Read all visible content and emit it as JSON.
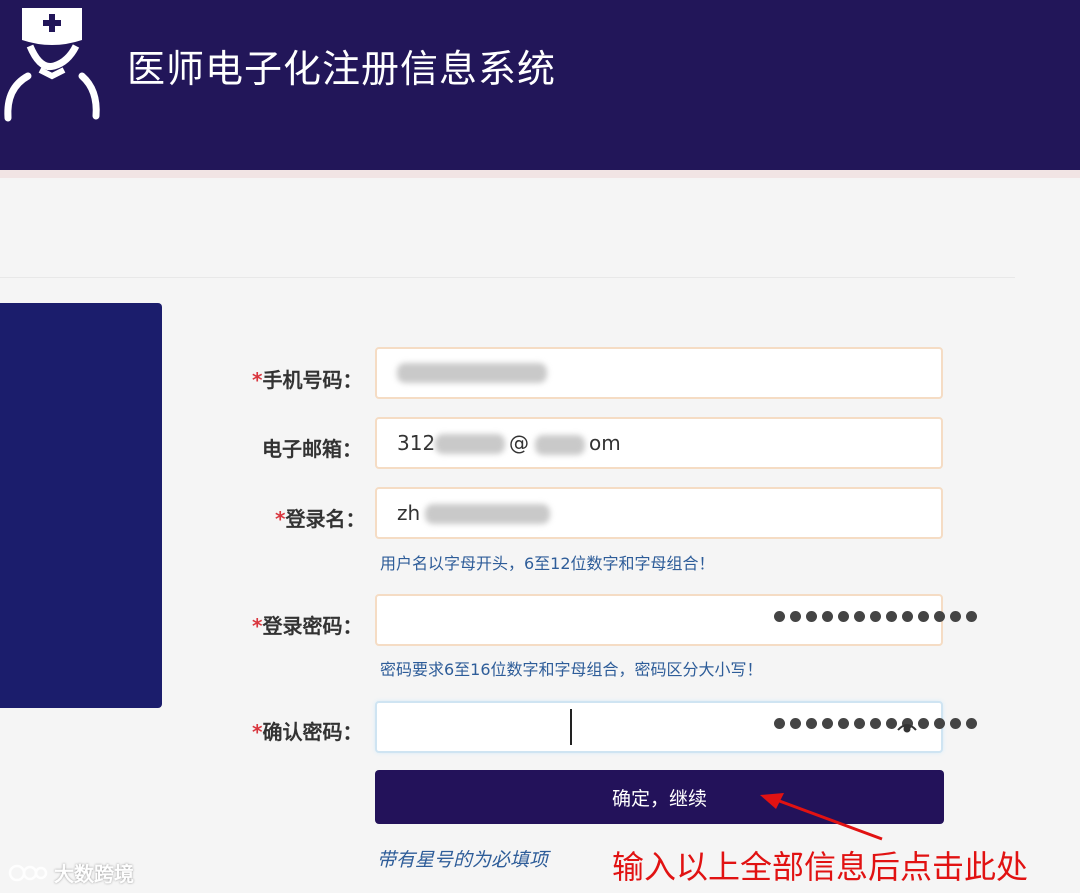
{
  "header": {
    "title": "医师电子化注册信息系统",
    "background": "#221659"
  },
  "form": {
    "required_mark": "*",
    "phone": {
      "label": "手机号码：",
      "required": true,
      "value_note": "blurred"
    },
    "email": {
      "label": "电子邮箱：",
      "required": false,
      "value_prefix": "312",
      "value_suffix": "@",
      "value_tail": "om"
    },
    "username": {
      "label": "登录名：",
      "required": true,
      "value_prefix": "zh",
      "hint": "用户名以字母开头，6至12位数字和字母组合！"
    },
    "password": {
      "label": "登录密码：",
      "required": true,
      "masked_length": 13,
      "hint": "密码要求6至16位数字和字母组合，密码区分大小写！"
    },
    "confirm_password": {
      "label": "确认密码：",
      "required": true,
      "masked_length": 13,
      "toggle_icon": "eye-icon"
    },
    "submit_label": "确定，继续",
    "required_note": "带有星号的为必填项"
  },
  "annotation": {
    "text": "输入以上全部信息后点击此处",
    "color": "#e11212"
  },
  "watermark": {
    "text": "大数跨境"
  },
  "colors": {
    "accent": "#23125a",
    "side_panel": "#1b1d6c",
    "field_border": "#f5dcc4",
    "hint": "#2e5d99",
    "required": "#d9363e"
  }
}
